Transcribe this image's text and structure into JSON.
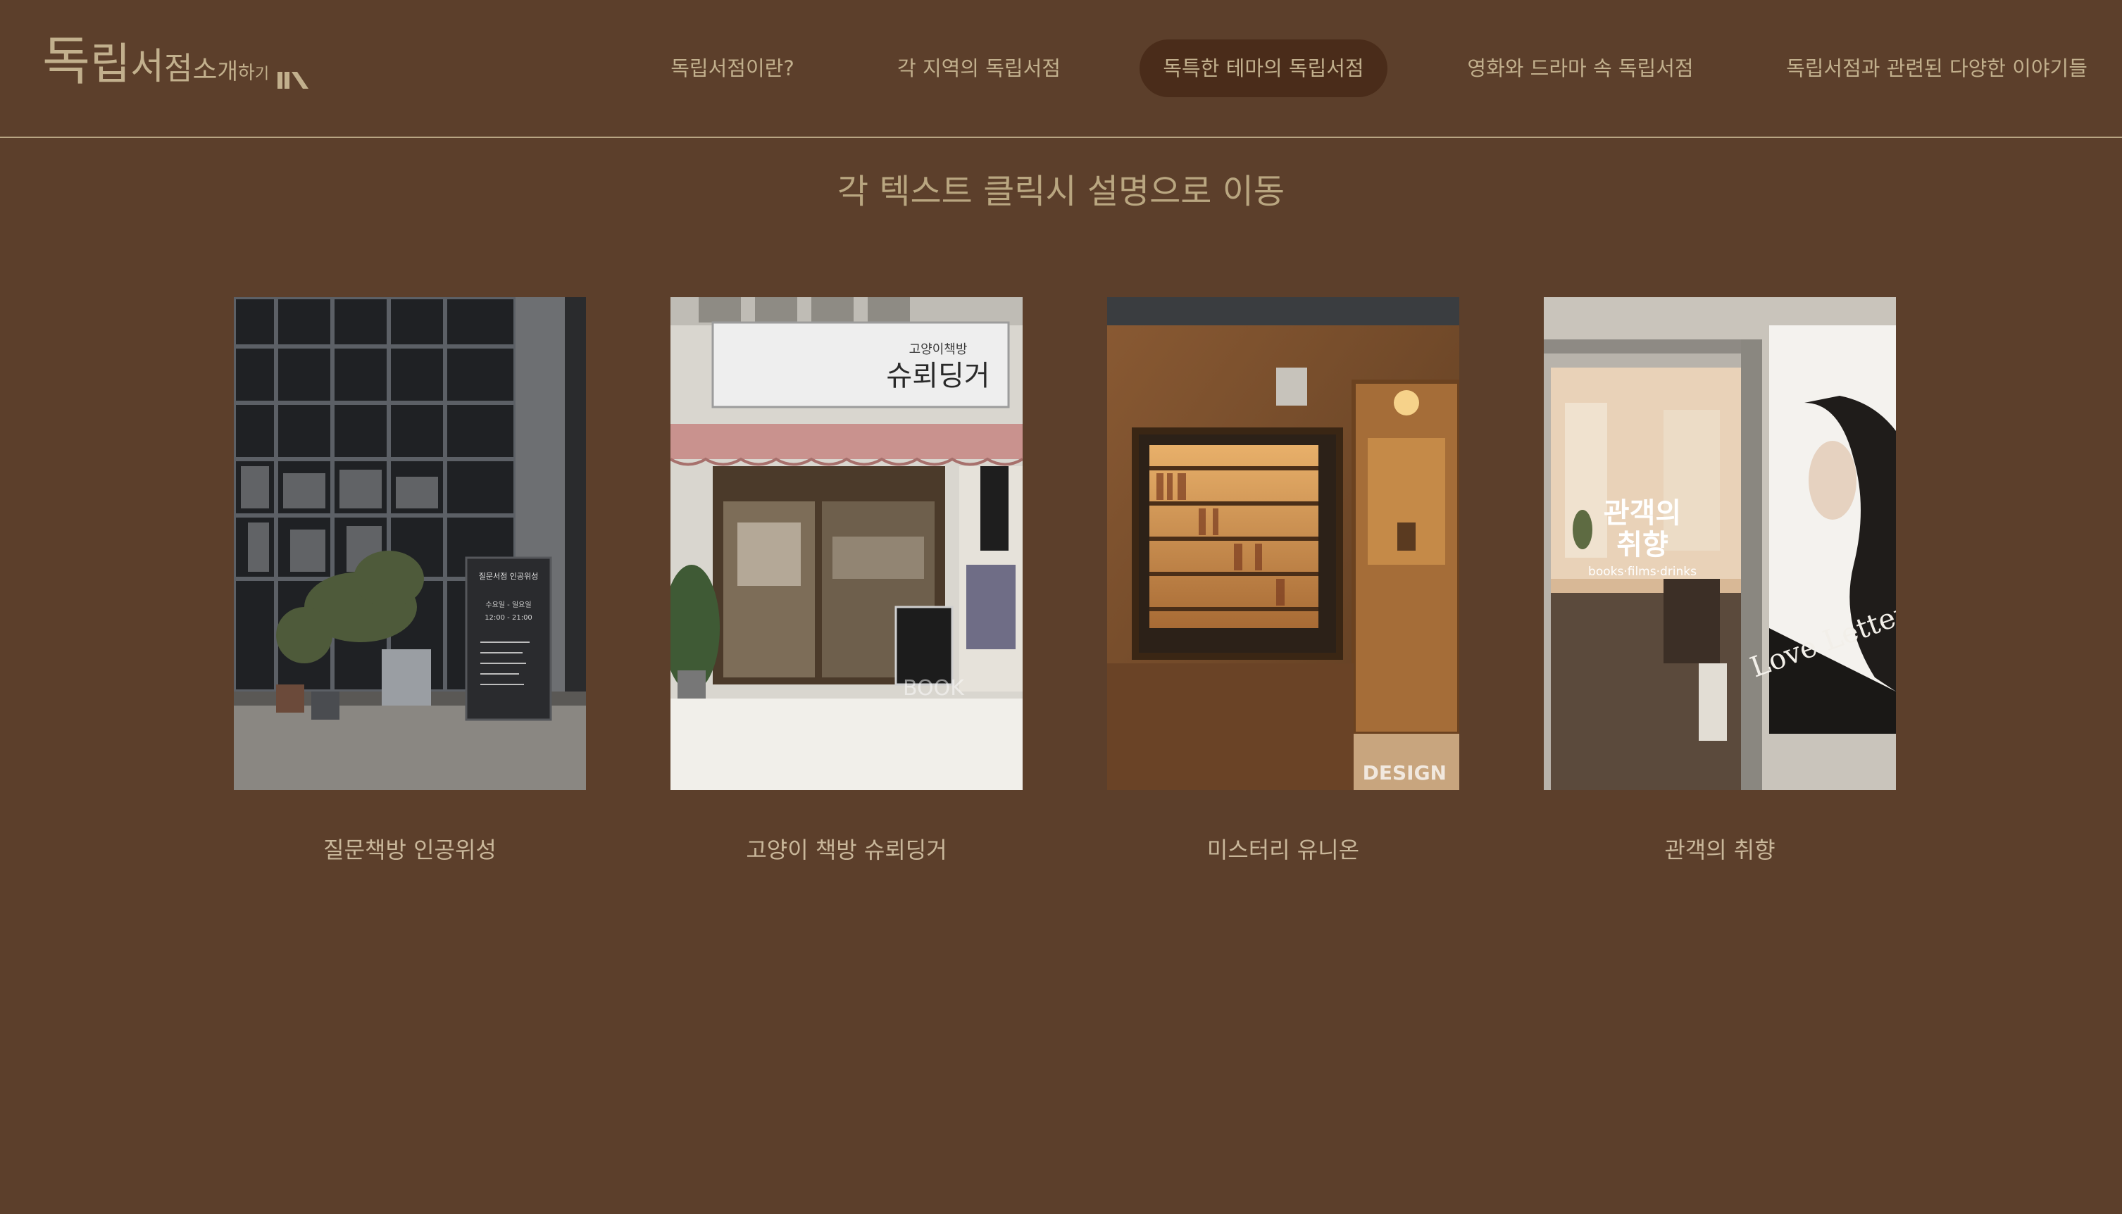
{
  "header": {
    "logo": {
      "chars": [
        "독",
        "립",
        "서",
        "점",
        "소",
        "개",
        "하",
        "기"
      ]
    },
    "nav": [
      {
        "label": "독립서점이란?",
        "active": false
      },
      {
        "label": "각 지역의 독립서점",
        "active": false
      },
      {
        "label": "독특한 테마의 독립서점",
        "active": true
      },
      {
        "label": "영화와 드라마 속 독립서점",
        "active": false
      },
      {
        "label": "독립서점과 관련된 다양한 이야기들",
        "active": false
      }
    ]
  },
  "main": {
    "subtitle": "각 텍스트 클릭시 설명으로 이동",
    "cards": [
      {
        "label": "질문책방 인공위성",
        "image": {
          "sign_title": "질문서점 인공위성",
          "sign_lines": [
            "수요일 - 일요일",
            "12:00 - 21:00"
          ]
        }
      },
      {
        "label": "고양이 책방 슈뢰딩거",
        "image": {
          "sign_small": "고양이책방",
          "sign_main": "슈뢰딩거",
          "watermark": "BOOK"
        }
      },
      {
        "label": "미스터리 유니온",
        "image": {
          "watermark": "DESIGN"
        }
      },
      {
        "label": "관객의 취향",
        "image": {
          "window_line1": "관객의",
          "window_line2": "취향",
          "window_sub": "books·films·drinks",
          "poster_title": "Love Letter"
        }
      }
    ]
  }
}
